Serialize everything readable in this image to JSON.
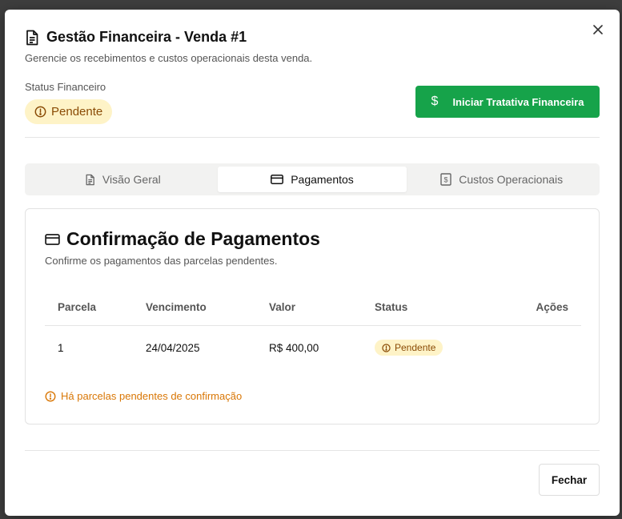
{
  "modal": {
    "title": "Gestão Financeira - Venda #1",
    "subtitle": "Gerencie os recebimentos e custos operacionais desta venda.",
    "status_label": "Status Financeiro",
    "status_value": "Pendente",
    "primary_action": "Iniciar Tratativa Financeira",
    "footer_close": "Fechar"
  },
  "tabs": [
    {
      "label": "Visão Geral",
      "icon": "file-text-icon",
      "active": false
    },
    {
      "label": "Pagamentos",
      "icon": "credit-card-icon",
      "active": true
    },
    {
      "label": "Custos Operacionais",
      "icon": "receipt-dollar-icon",
      "active": false
    }
  ],
  "payments": {
    "title": "Confirmação de Pagamentos",
    "subtitle": "Confirme os pagamentos das parcelas pendentes.",
    "columns": [
      "Parcela",
      "Vencimento",
      "Valor",
      "Status",
      "Ações"
    ],
    "rows": [
      {
        "parcela": "1",
        "vencimento": "24/04/2025",
        "valor": "R$ 400,00",
        "status": "Pendente"
      }
    ],
    "warning": "Há parcelas pendentes de confirmação"
  },
  "colors": {
    "accent_green": "#16a34a",
    "pending_bg": "#fef3c7",
    "pending_text": "#8a4b05",
    "warning": "#d97706"
  }
}
